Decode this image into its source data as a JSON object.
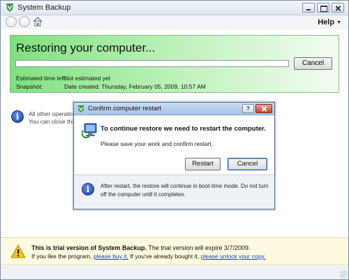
{
  "window": {
    "title": "System Backup",
    "help_menu": "Help"
  },
  "status_panel": {
    "heading": "Restoring your computer...",
    "progress": 0,
    "cancel_label": "Cancel",
    "time_left_label": "Estimated time left:",
    "time_left_value": "Not estimated yet",
    "snapshot_label": "Snapshot:",
    "snapshot_value": "Date created: Thursday, February 05, 2009, 10:57 AM"
  },
  "background_info": {
    "line1": "All other operations",
    "line2": "You can close this"
  },
  "dialog": {
    "title": "Confirm computer restart",
    "help_button": "?",
    "message": "To continue restore we need to restart the computer.",
    "sub_message": "Please save your work and confirm restart.",
    "restart_label": "Restart",
    "cancel_label": "Cancel",
    "footer_note": "After restart, the restore will continue in boot-time mode. Do not turn off the computer until it completes."
  },
  "trial_bar": {
    "bold_text": "This is trial version of System Backup.",
    "expire_text": " The trial version will expire 3/7/2009.",
    "line2_prefix": "If you like the program, ",
    "buy_link": "please buy it.",
    "line2_middle": " If you've already bought it, ",
    "unlock_link": "please unlock your copy."
  },
  "colors": {
    "panel_green": "#7fe07f",
    "link_blue": "#1b3fb5",
    "trial_bg": "#fefadf"
  },
  "icons": [
    "app-logo-icon",
    "back-icon",
    "forward-icon",
    "home-icon",
    "info-icon",
    "restart-computer-icon",
    "warning-icon"
  ]
}
